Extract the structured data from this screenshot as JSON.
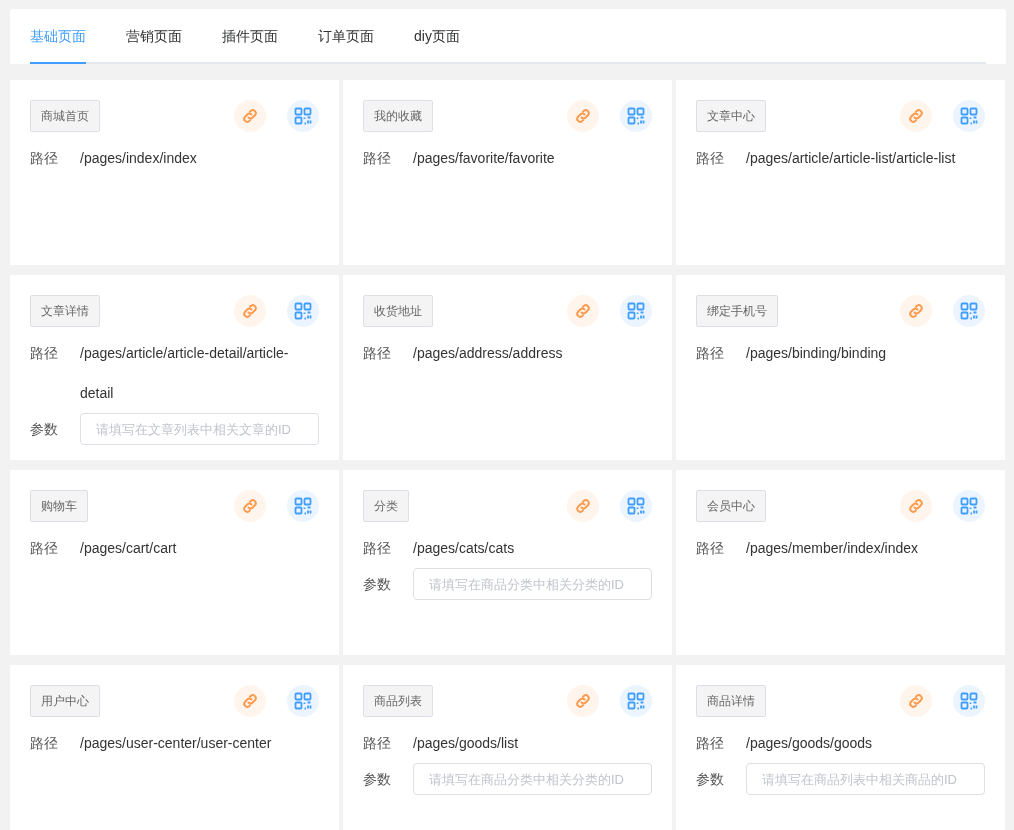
{
  "tabs": [
    {
      "label": "基础页面",
      "selected": true
    },
    {
      "label": "营销页面",
      "selected": false
    },
    {
      "label": "插件页面",
      "selected": false
    },
    {
      "label": "订单页面",
      "selected": false
    },
    {
      "label": "diy页面",
      "selected": false
    }
  ],
  "cards": [
    {
      "tag": "商城首页",
      "path_label": "路径",
      "path": "/pages/index/index"
    },
    {
      "tag": "我的收藏",
      "path_label": "路径",
      "path": "/pages/favorite/favorite"
    },
    {
      "tag": "文章中心",
      "path_label": "路径",
      "path": "/pages/article/article-list/article-list"
    },
    {
      "tag": "文章详情",
      "path_label": "路径",
      "path": "/pages/article/article-detail/article-detail",
      "param_label": "参数",
      "placeholder": "请填写在文章列表中相关文章的ID"
    },
    {
      "tag": "收货地址",
      "path_label": "路径",
      "path": "/pages/address/address"
    },
    {
      "tag": "绑定手机号",
      "path_label": "路径",
      "path": "/pages/binding/binding"
    },
    {
      "tag": "购物车",
      "path_label": "路径",
      "path": "/pages/cart/cart"
    },
    {
      "tag": "分类",
      "path_label": "路径",
      "path": "/pages/cats/cats",
      "param_label": "参数",
      "placeholder": "请填写在商品分类中相关分类的ID"
    },
    {
      "tag": "会员中心",
      "path_label": "路径",
      "path": "/pages/member/index/index"
    },
    {
      "tag": "用户中心",
      "path_label": "路径",
      "path": "/pages/user-center/user-center"
    },
    {
      "tag": "商品列表",
      "path_label": "路径",
      "path": "/pages/goods/list",
      "param_label": "参数",
      "placeholder": "请填写在商品分类中相关分类的ID"
    },
    {
      "tag": "商品详情",
      "path_label": "路径",
      "path": "/pages/goods/goods",
      "param_label": "参数",
      "placeholder": "请填写在商品列表中相关商品的ID"
    }
  ]
}
